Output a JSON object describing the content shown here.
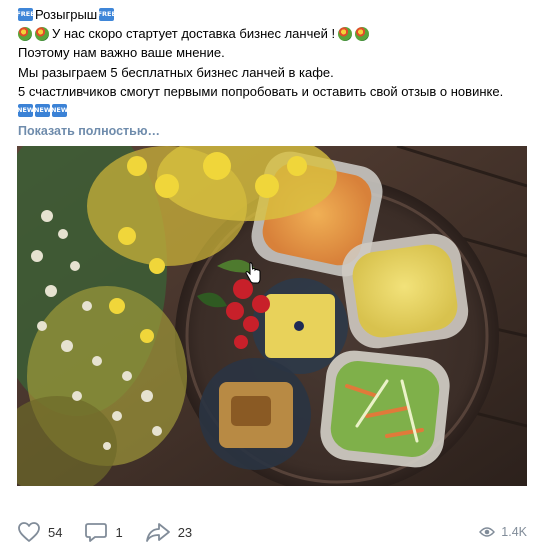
{
  "post": {
    "title": "Розыгрыш",
    "badge_free": "FREE",
    "line1": "У нас скоро стартует доставка бизнес ланчей !",
    "line2": "Поэтому нам важно ваше мнение.",
    "line3": "Мы разыграем 5 бесплатных бизнес ланчей в кафе.",
    "line4": "5 счастливчиков смогут первыми попробовать и оставить свой отзыв о новинке.",
    "badge_new": "NEW",
    "show_more": "Показать полностью…"
  },
  "photo": {
    "icon": "food-photo"
  },
  "actions": {
    "likes": "54",
    "comments": "1",
    "shares": "23",
    "views": "1.4K"
  },
  "colors": {
    "link": "#6f8cac",
    "badge": "#3b82d6",
    "muted": "#818c99"
  }
}
